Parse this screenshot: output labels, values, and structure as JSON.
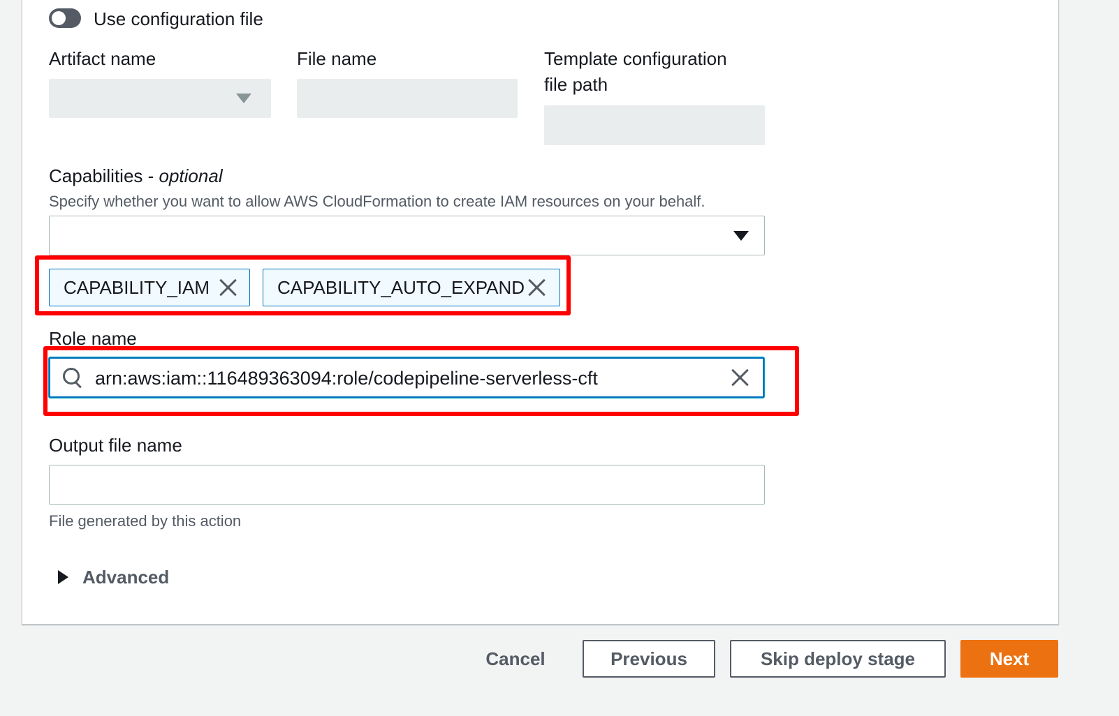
{
  "config_file": {
    "toggle_label": "Use configuration file",
    "enabled": false
  },
  "fields": {
    "artifact_name_label": "Artifact name",
    "file_name_label": "File name",
    "template_config_label_line1": "Template configuration",
    "template_config_label_line2": "file path"
  },
  "capabilities": {
    "label": "Capabilities - ",
    "label_optional": "optional",
    "description": "Specify whether you want to allow AWS CloudFormation to create IAM resources on your behalf.",
    "tokens": [
      "CAPABILITY_IAM",
      "CAPABILITY_AUTO_EXPAND"
    ]
  },
  "role": {
    "label": "Role name",
    "value": "arn:aws:iam::116489363094:role/codepipeline-serverless-cft"
  },
  "output": {
    "label": "Output file name",
    "value": "",
    "description": "File generated by this action"
  },
  "advanced": {
    "label": "Advanced"
  },
  "footer": {
    "cancel": "Cancel",
    "previous": "Previous",
    "skip": "Skip deploy stage",
    "next": "Next"
  },
  "colors": {
    "primary": "#ec7211",
    "highlight": "#ff0000",
    "token_border": "#0073bb"
  }
}
